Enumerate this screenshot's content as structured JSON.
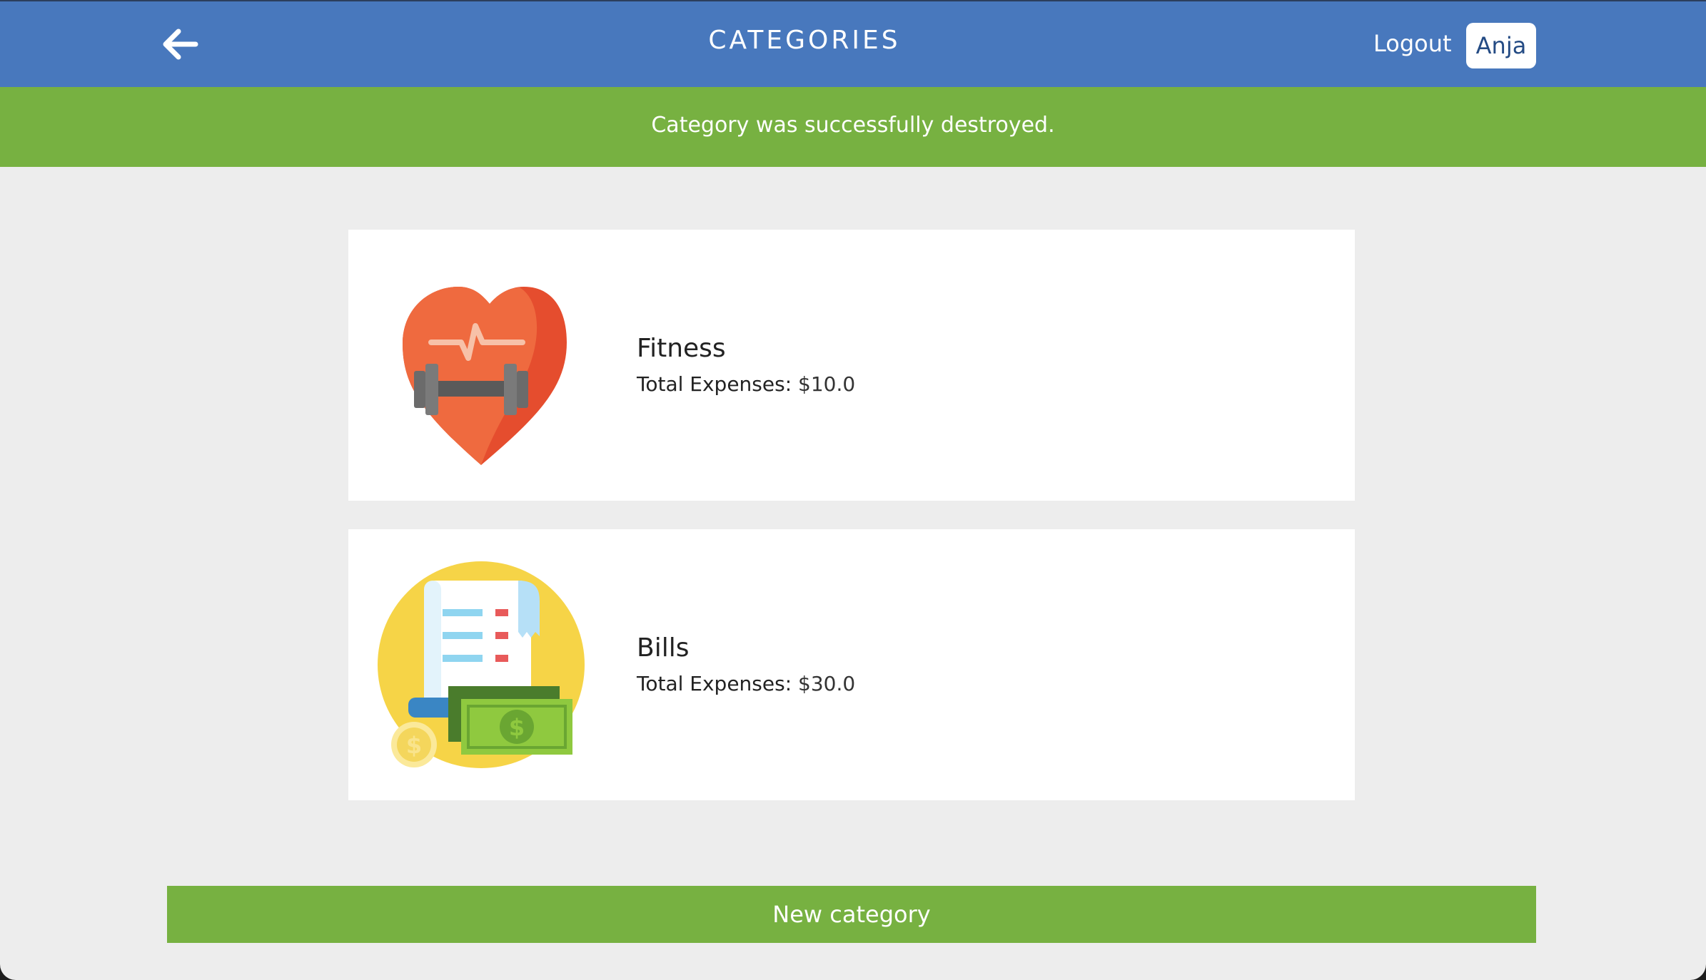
{
  "header": {
    "title": "CATEGORIES",
    "logout_label": "Logout",
    "user_name": "Anja"
  },
  "flash": {
    "message": "Category was successfully destroyed."
  },
  "categories": [
    {
      "name": "Fitness",
      "expenses_label": "Total Expenses:",
      "expenses_value": "$10.0",
      "icon": "heart-dumbbell-icon"
    },
    {
      "name": "Bills",
      "expenses_label": "Total Expenses:",
      "expenses_value": "$30.0",
      "icon": "bills-money-icon"
    }
  ],
  "actions": {
    "new_category_label": "New category"
  },
  "colors": {
    "header": "#4878bd",
    "success": "#77b141",
    "background": "#ededed"
  }
}
